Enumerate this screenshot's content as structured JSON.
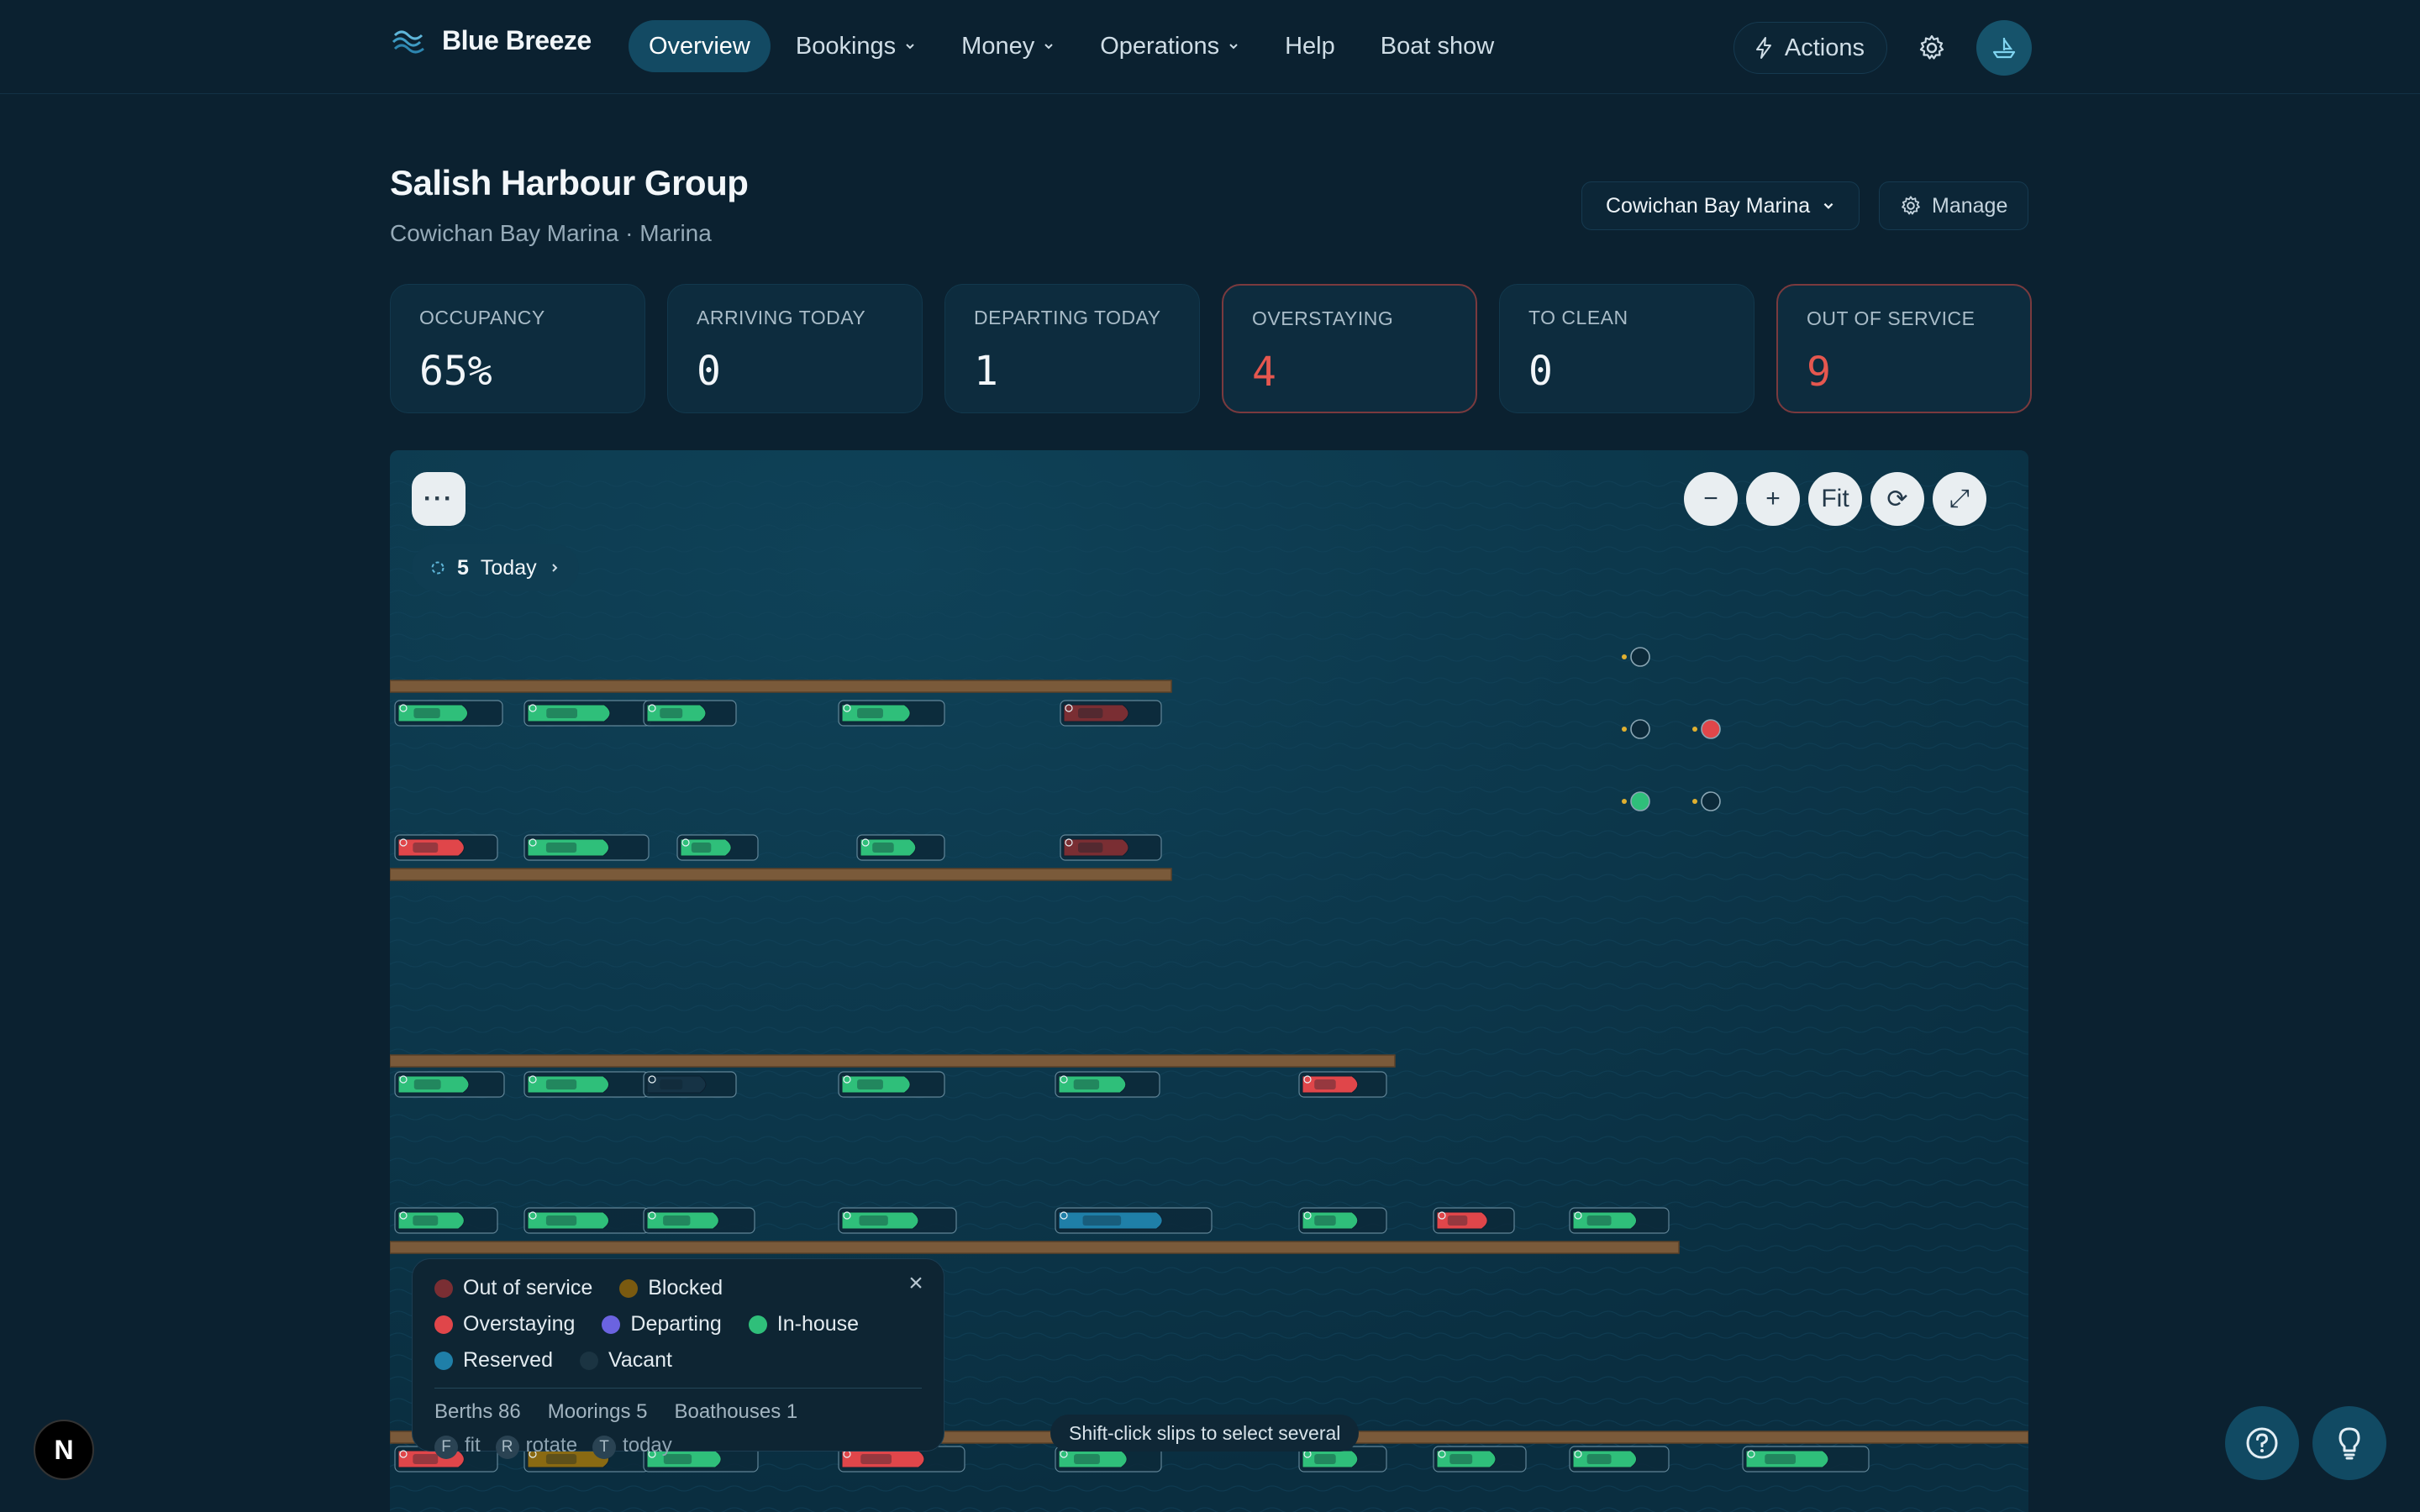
{
  "brand": {
    "name": "Blue Breeze"
  },
  "nav": {
    "items": [
      {
        "label": "Overview",
        "active": true,
        "dropdown": false
      },
      {
        "label": "Bookings",
        "active": false,
        "dropdown": true
      },
      {
        "label": "Money",
        "active": false,
        "dropdown": true
      },
      {
        "label": "Operations",
        "active": false,
        "dropdown": true
      },
      {
        "label": "Help",
        "active": false,
        "dropdown": false
      },
      {
        "label": "Boat show",
        "active": false,
        "dropdown": false
      }
    ],
    "actions_label": "Actions"
  },
  "header": {
    "title": "Salish Harbour Group",
    "subtitle": "Cowichan Bay Marina · Marina",
    "marina_select": "Cowichan Bay Marina",
    "manage_label": "Manage"
  },
  "stats": [
    {
      "label": "OCCUPANCY",
      "value": "65%",
      "alert": false
    },
    {
      "label": "ARRIVING TODAY",
      "value": "0",
      "alert": false
    },
    {
      "label": "DEPARTING TODAY",
      "value": "1",
      "alert": false
    },
    {
      "label": "OVERSTAYING",
      "value": "4",
      "alert": true
    },
    {
      "label": "TO CLEAN",
      "value": "0",
      "alert": false
    },
    {
      "label": "OUT OF SERVICE",
      "value": "9",
      "alert": true
    }
  ],
  "map": {
    "more_label": "···",
    "zoom": {
      "minus": "−",
      "plus": "+",
      "fit": "Fit",
      "rotate": "⟳",
      "expand": "⤢"
    },
    "today_chip": {
      "count": "5",
      "label": "Today"
    },
    "tooltip": "Shift-click slips to select several"
  },
  "legend": {
    "close": "×",
    "rows": [
      [
        {
          "label": "Out of service",
          "color": "#7a2e33"
        },
        {
          "label": "Blocked",
          "color": "#7a5a10"
        }
      ],
      [
        {
          "label": "Overstaying",
          "color": "#e0464a"
        },
        {
          "label": "Departing",
          "color": "#6b63e0"
        },
        {
          "label": "In-house",
          "color": "#2fbf7a"
        }
      ],
      [
        {
          "label": "Reserved",
          "color": "#1f7fa8"
        },
        {
          "label": "Vacant",
          "color": "#1b3442"
        }
      ]
    ],
    "counts": [
      "Berths 86",
      "Moorings 5",
      "Boathouses 1"
    ],
    "keys": [
      {
        "key": "F",
        "label": "fit"
      },
      {
        "key": "R",
        "label": "rotate"
      },
      {
        "key": "T",
        "label": "today"
      }
    ]
  },
  "colors": {
    "inhouse": "#2fbf7a",
    "overstaying": "#e0464a",
    "out_of_service": "#7a2e33",
    "reserved": "#1f7fa8",
    "vacant": "#163345",
    "blocked": "#8a6a12",
    "dock": "#7a5a3a"
  },
  "badge": "N"
}
